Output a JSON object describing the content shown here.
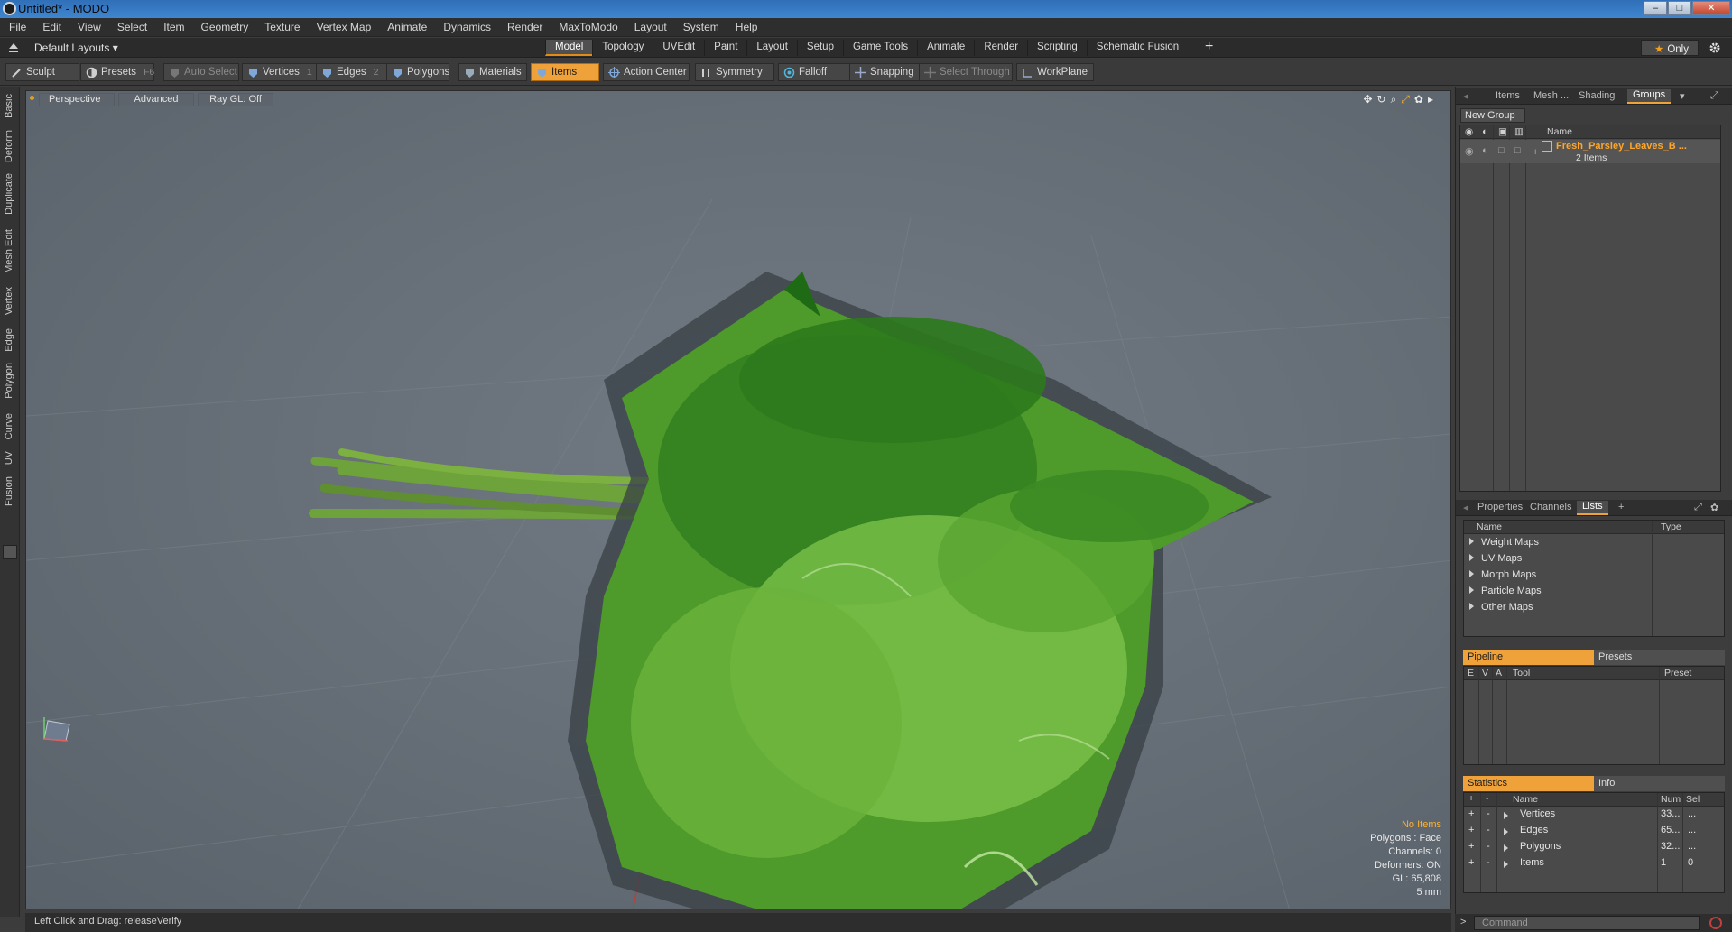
{
  "window": {
    "title": "Untitled* - MODO",
    "min": "–",
    "max": "□",
    "close": "✕"
  },
  "menu": [
    "File",
    "Edit",
    "View",
    "Select",
    "Item",
    "Geometry",
    "Texture",
    "Vertex Map",
    "Animate",
    "Dynamics",
    "Render",
    "MaxToModo",
    "Layout",
    "System",
    "Help"
  ],
  "layoutbar": {
    "layouts": "Default Layouts ▾",
    "tabs": [
      "Model",
      "Topology",
      "UVEdit",
      "Paint",
      "Layout",
      "Setup",
      "Game Tools",
      "Animate",
      "Render",
      "Scripting",
      "Schematic Fusion"
    ],
    "active_tab": "Model",
    "add": "+",
    "only": "Only"
  },
  "toolbar": {
    "sculpt": "Sculpt",
    "presets": "Presets",
    "presets_key": "F6",
    "auto_select": "Auto Select",
    "vertices": "Vertices",
    "vertices_num": "1",
    "edges": "Edges",
    "edges_num": "2",
    "polygons": "Polygons",
    "materials": "Materials",
    "items": "Items",
    "action_center": "Action Center",
    "symmetry": "Symmetry",
    "falloff": "Falloff",
    "snapping": "Snapping",
    "select_through": "Select Through",
    "workplane": "WorkPlane"
  },
  "left_tabs": [
    "Basic",
    "Deform",
    "Duplicate",
    "Mesh Edit",
    "Vertex",
    "Edge",
    "Polygon",
    "Curve",
    "UV",
    "Fusion"
  ],
  "viewport": {
    "view": "Perspective",
    "shading": "Advanced",
    "raygl": "Ray GL: Off",
    "info": {
      "no_items": "No Items",
      "polygons": "Polygons : Face",
      "channels": "Channels: 0",
      "deformers": "Deformers: ON",
      "gl": "GL: 65,808",
      "unit": "5 mm"
    },
    "colors": {
      "leaf": "#4e9a2a",
      "leaf_light": "#7cc24a",
      "stem": "#6ea23a"
    }
  },
  "status": "Left Click and Drag:   releaseVerify",
  "right": {
    "top_tabs": [
      "Items",
      "Mesh ...",
      "Shading",
      "Groups"
    ],
    "active_top": "Groups",
    "new_group": "New Group",
    "name_col": "Name",
    "group_name": "Fresh_Parsley_Leaves_B ...",
    "group_count": "2 Items",
    "mid_tabs": [
      "Properties",
      "Channels",
      "Lists"
    ],
    "active_mid": "Lists",
    "lists_plus": "+",
    "lists": {
      "name_col": "Name",
      "type_col": "Type",
      "items": [
        "Weight Maps",
        "UV Maps",
        "Morph Maps",
        "Particle Maps",
        "Other Maps"
      ]
    },
    "pipeline": {
      "tab": "Pipeline",
      "presets": "Presets",
      "cols": [
        "E",
        "V",
        "A",
        "Tool",
        "Preset"
      ]
    },
    "stats": {
      "tab": "Statistics",
      "info": "Info",
      "cols": [
        "+",
        "-",
        "Name",
        "Num",
        "Sel"
      ],
      "rows": [
        {
          "name": "Vertices",
          "num": "33...",
          "sel": "..."
        },
        {
          "name": "Edges",
          "num": "65...",
          "sel": "..."
        },
        {
          "name": "Polygons",
          "num": "32...",
          "sel": "..."
        },
        {
          "name": "Items",
          "num": "1",
          "sel": "0"
        }
      ]
    },
    "command_placeholder": "Command",
    "prompt": ">"
  }
}
